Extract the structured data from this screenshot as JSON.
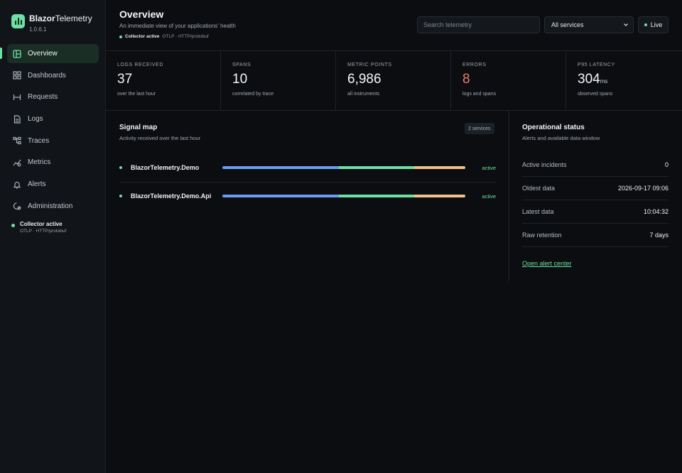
{
  "brand": {
    "name_bold": "Blazor",
    "name_rest": "Telemetry",
    "version": "1.0.6.1"
  },
  "sidebar": {
    "items": [
      {
        "label": "Overview",
        "icon": "layout-icon"
      },
      {
        "label": "Dashboards",
        "icon": "grid-icon"
      },
      {
        "label": "Requests",
        "icon": "requests-icon"
      },
      {
        "label": "Logs",
        "icon": "document-icon"
      },
      {
        "label": "Traces",
        "icon": "traces-icon"
      },
      {
        "label": "Metrics",
        "icon": "metrics-icon"
      },
      {
        "label": "Alerts",
        "icon": "bell-icon"
      },
      {
        "label": "Administration",
        "icon": "admin-icon"
      }
    ],
    "collector": {
      "title": "Collector active",
      "sub": "OTLP · HTTP/protobuf"
    }
  },
  "header": {
    "title": "Overview",
    "subtitle": "An immediate view of your applications' health",
    "collector_label": "Collector active",
    "collector_proto": "OTLP · HTTP/protobuf",
    "search_placeholder": "Search telemetry",
    "service_select": "All services",
    "live_label": "Live"
  },
  "stats": [
    {
      "label": "LOGS RECEIVED",
      "value": "37",
      "unit": "",
      "sub": "over the last hour"
    },
    {
      "label": "SPANS",
      "value": "10",
      "unit": "",
      "sub": "correlated by trace"
    },
    {
      "label": "METRIC POINTS",
      "value": "6,986",
      "unit": "",
      "sub": "all instruments"
    },
    {
      "label": "ERRORS",
      "value": "8",
      "unit": "",
      "sub": "logs and spans"
    },
    {
      "label": "P95 LATENCY",
      "value": "304",
      "unit": "ms",
      "sub": "observed spans"
    }
  ],
  "signal_map": {
    "title": "Signal map",
    "subtitle": "Activity received over the last hour",
    "badge": "2 services",
    "segment_colors": [
      "#6b9cf2",
      "#6fe0a3",
      "#f2c08a"
    ],
    "services": [
      {
        "name": "BlazorTelemetry.Demo",
        "status": "active",
        "shares": [
          0.48,
          0.31,
          0.21
        ]
      },
      {
        "name": "BlazorTelemetry.Demo.Api",
        "status": "active",
        "shares": [
          0.48,
          0.31,
          0.21
        ]
      }
    ]
  },
  "operational": {
    "title": "Operational status",
    "subtitle": "Alerts and available data window",
    "rows": [
      {
        "key": "Active incidents",
        "value": "0"
      },
      {
        "key": "Oldest data",
        "value": "2026-09-17 09:06"
      },
      {
        "key": "Latest data",
        "value": "10:04:32"
      },
      {
        "key": "Raw retention",
        "value": "7 days"
      }
    ],
    "link": "Open alert center"
  }
}
